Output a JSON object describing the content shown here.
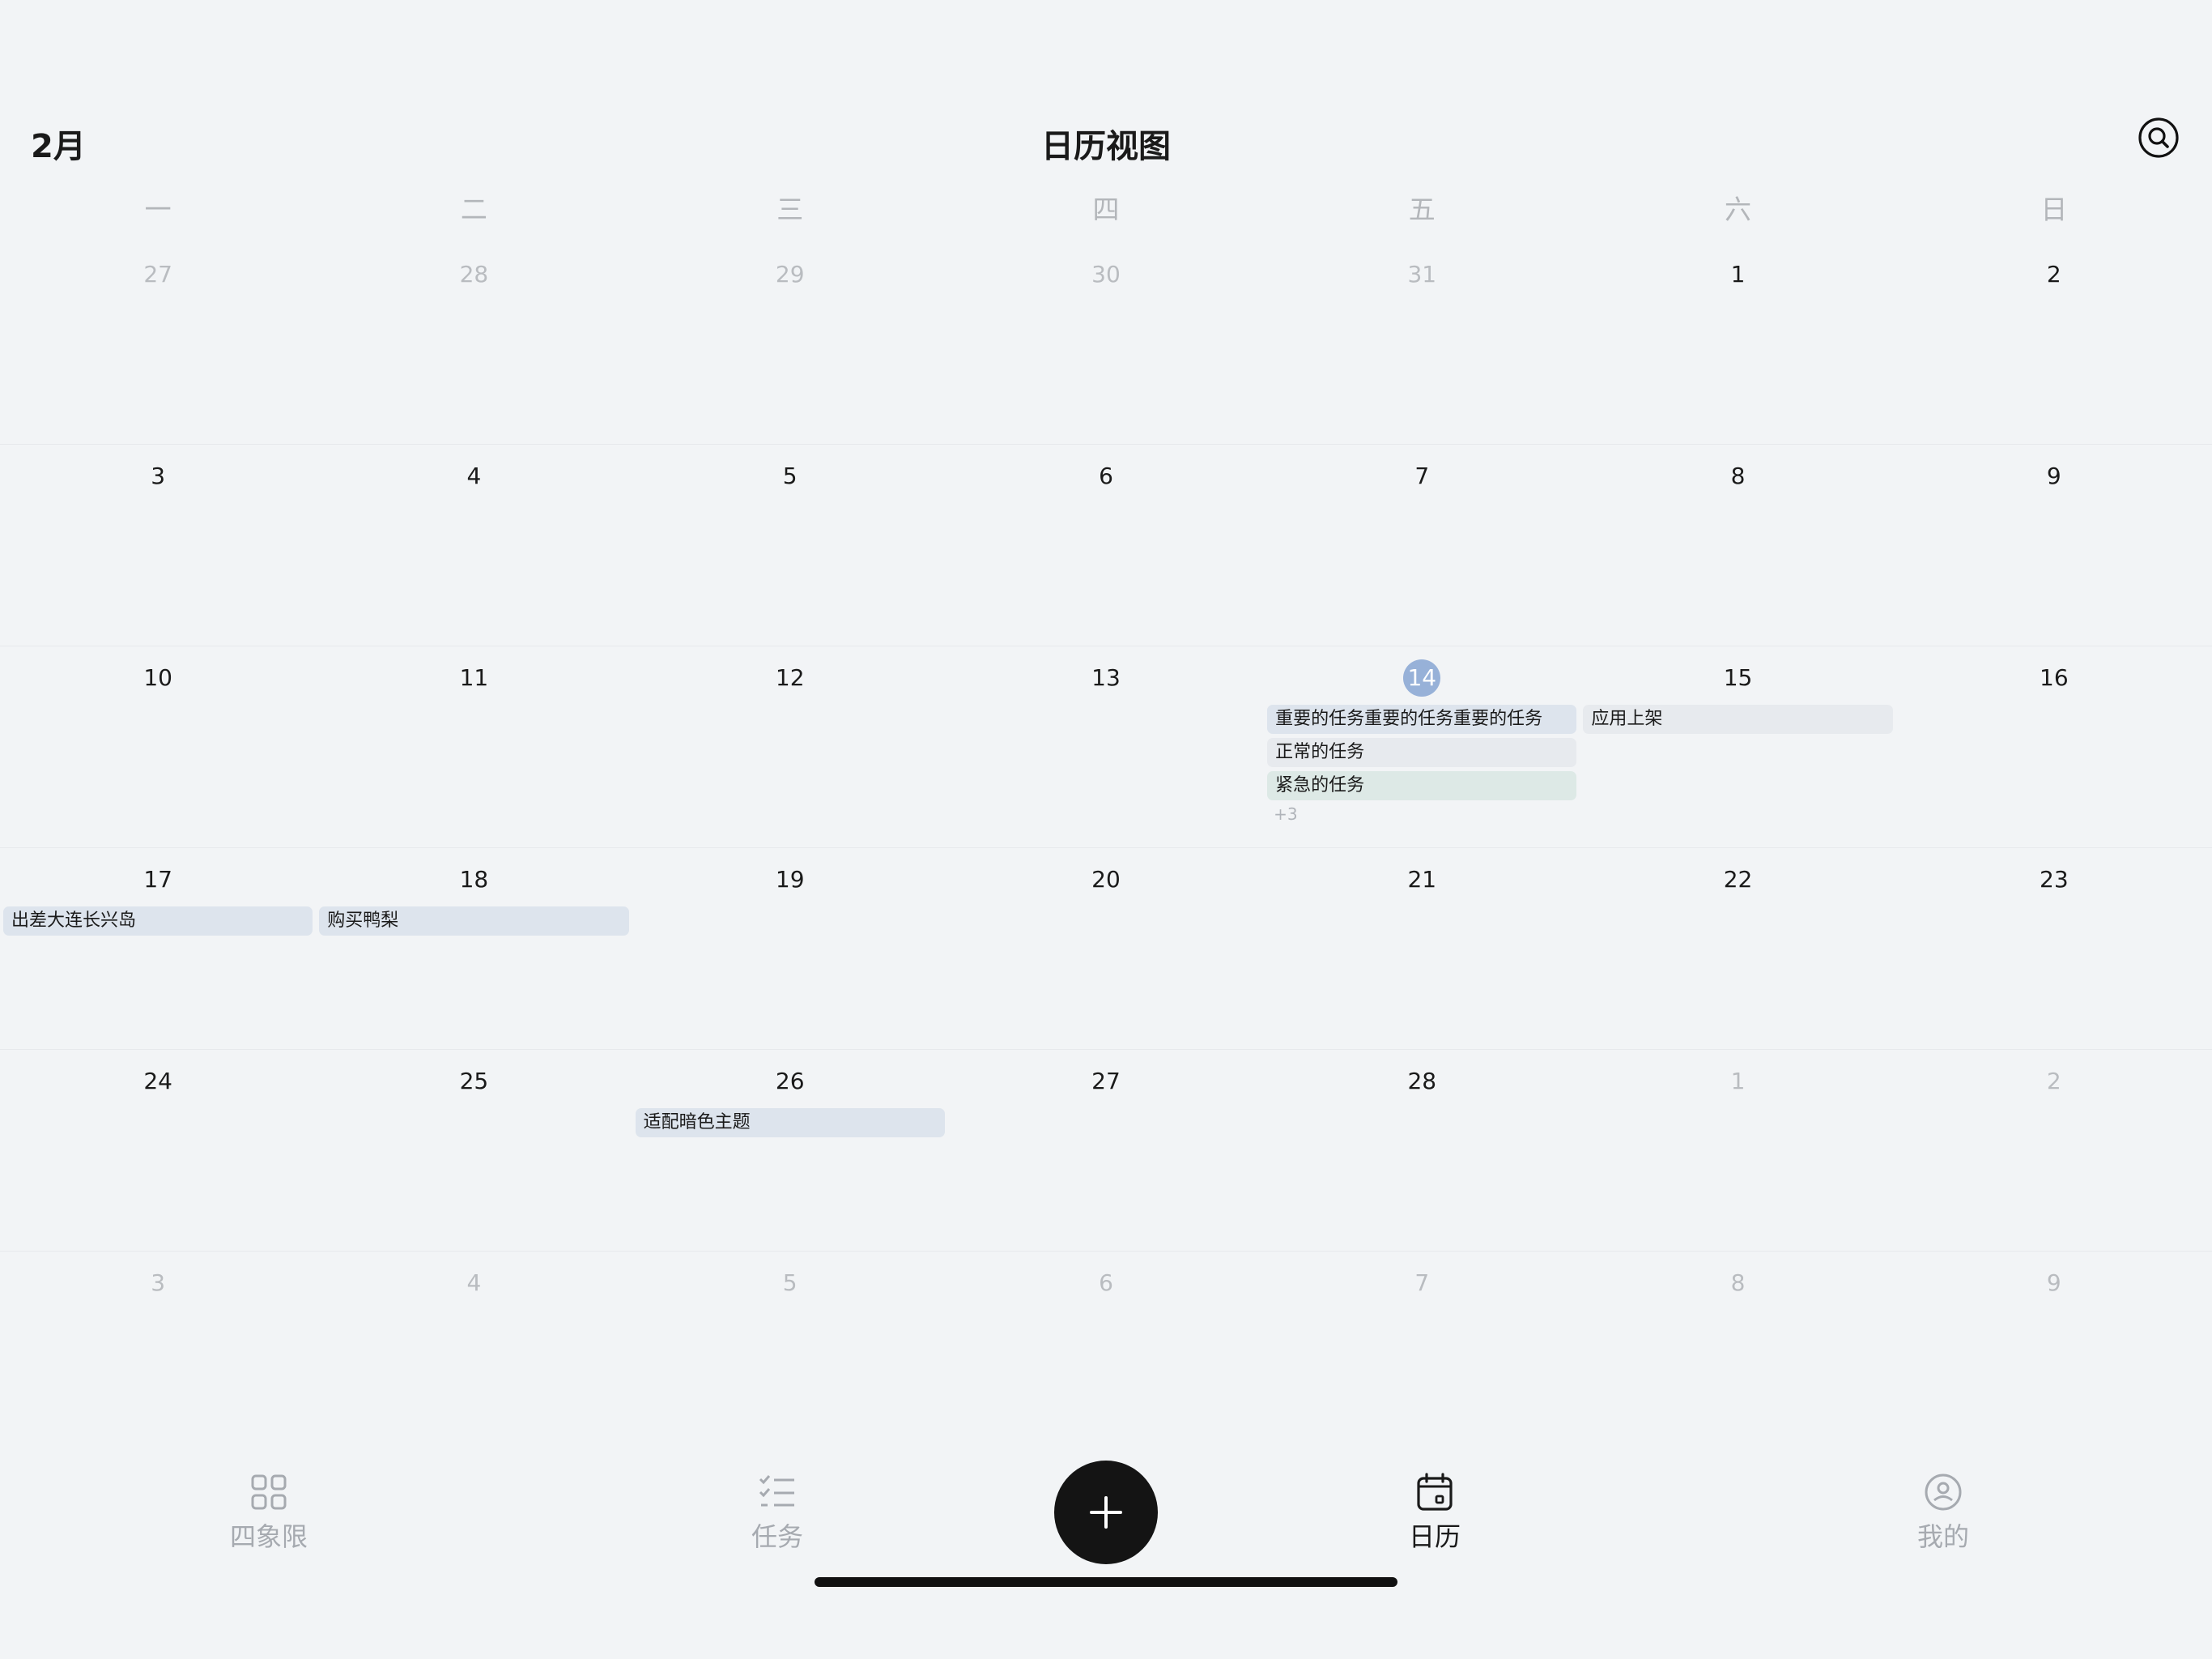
{
  "header": {
    "month": "2月",
    "title": "日历视图",
    "search_icon": "search-icon"
  },
  "weekdays": [
    "一",
    "二",
    "三",
    "四",
    "五",
    "六",
    "日"
  ],
  "colors": {
    "today": "#97b1d8",
    "event_important": "#dde4ed",
    "event_normal": "#e7eaee",
    "event_urgent": "#dde9e6",
    "fab": "#141414"
  },
  "calendar": {
    "weeks": [
      {
        "days": [
          {
            "num": "27",
            "muted": true
          },
          {
            "num": "28",
            "muted": true
          },
          {
            "num": "29",
            "muted": true
          },
          {
            "num": "30",
            "muted": true
          },
          {
            "num": "31",
            "muted": true
          },
          {
            "num": "1"
          },
          {
            "num": "2"
          }
        ]
      },
      {
        "days": [
          {
            "num": "3"
          },
          {
            "num": "4"
          },
          {
            "num": "5"
          },
          {
            "num": "6"
          },
          {
            "num": "7"
          },
          {
            "num": "8"
          },
          {
            "num": "9"
          }
        ]
      },
      {
        "days": [
          {
            "num": "10"
          },
          {
            "num": "11"
          },
          {
            "num": "12"
          },
          {
            "num": "13"
          },
          {
            "num": "14",
            "today": true,
            "events": [
              {
                "title": "重要的任务重要的任务重要的任务",
                "kind": "important"
              },
              {
                "title": "正常的任务",
                "kind": "normal"
              },
              {
                "title": "紧急的任务",
                "kind": "urgent"
              }
            ],
            "more": "+3"
          },
          {
            "num": "15",
            "events": [
              {
                "title": "应用上架",
                "kind": "normal"
              }
            ]
          },
          {
            "num": "16"
          }
        ]
      },
      {
        "days": [
          {
            "num": "17",
            "events": [
              {
                "title": "出差大连长兴岛",
                "kind": "important"
              }
            ]
          },
          {
            "num": "18",
            "events": [
              {
                "title": "购买鸭梨",
                "kind": "important"
              }
            ]
          },
          {
            "num": "19"
          },
          {
            "num": "20"
          },
          {
            "num": "21"
          },
          {
            "num": "22"
          },
          {
            "num": "23"
          }
        ]
      },
      {
        "days": [
          {
            "num": "24"
          },
          {
            "num": "25"
          },
          {
            "num": "26",
            "events": [
              {
                "title": "适配暗色主题",
                "kind": "important"
              }
            ]
          },
          {
            "num": "27"
          },
          {
            "num": "28"
          },
          {
            "num": "1",
            "muted": true
          },
          {
            "num": "2",
            "muted": true
          }
        ]
      },
      {
        "days": [
          {
            "num": "3",
            "muted": true
          },
          {
            "num": "4",
            "muted": true
          },
          {
            "num": "5",
            "muted": true
          },
          {
            "num": "6",
            "muted": true
          },
          {
            "num": "7",
            "muted": true
          },
          {
            "num": "8",
            "muted": true
          },
          {
            "num": "9",
            "muted": true
          }
        ]
      }
    ]
  },
  "tabbar": {
    "items": [
      {
        "label": "四象限",
        "icon": "quadrant-grid-icon",
        "active": false
      },
      {
        "label": "任务",
        "icon": "task-list-icon",
        "active": false
      },
      {
        "label": "日历",
        "icon": "calendar-icon",
        "active": true
      },
      {
        "label": "我的",
        "icon": "profile-icon",
        "active": false
      }
    ],
    "fab_icon": "plus-icon"
  }
}
